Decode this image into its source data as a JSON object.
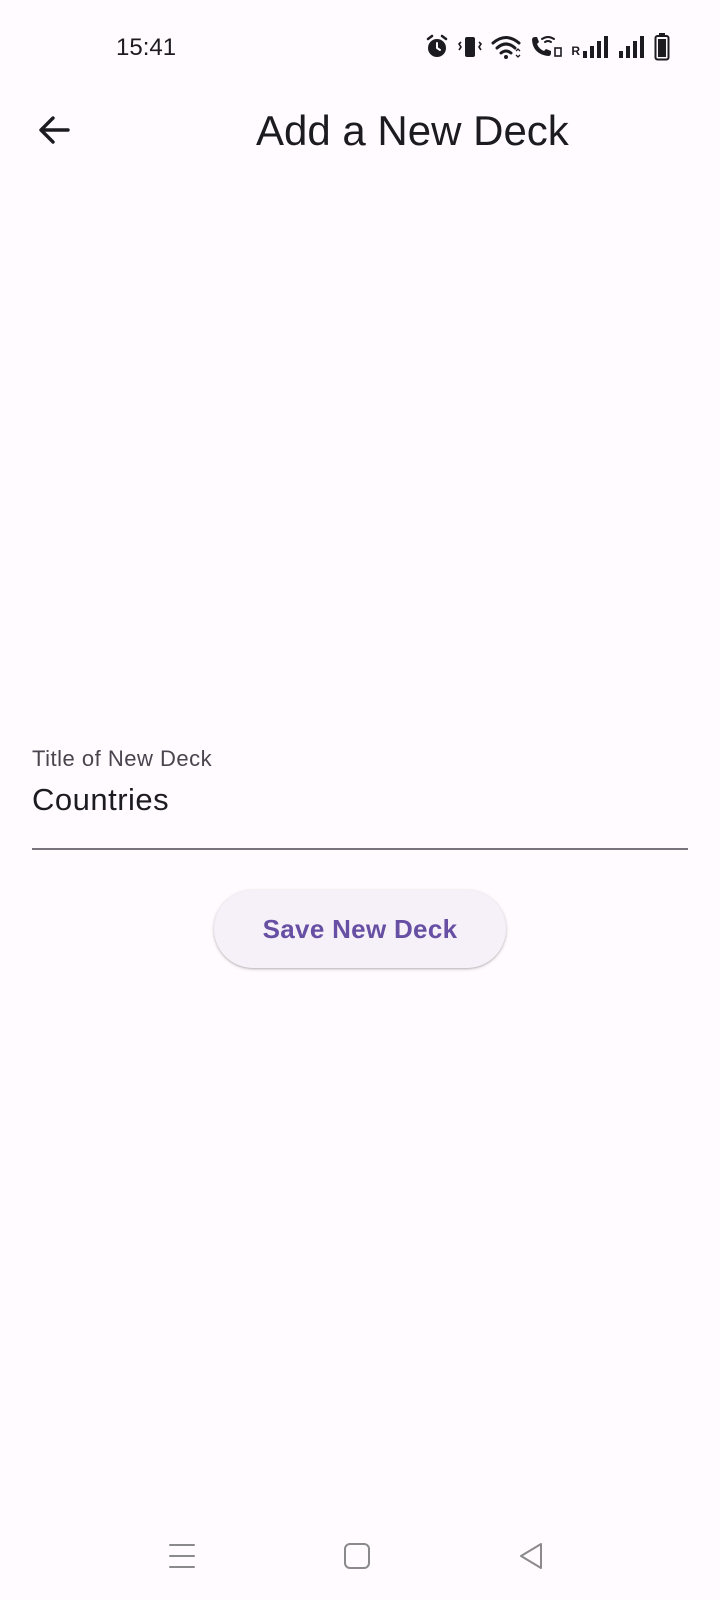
{
  "status_bar": {
    "time": "15:41",
    "icons": [
      "alarm-icon",
      "vibrate-icon",
      "wifi-icon",
      "wifi-calling-icon",
      "signal-roaming-icon",
      "signal-icon",
      "battery-icon"
    ],
    "roaming_letter": "R"
  },
  "app_bar": {
    "back_icon": "arrow-back-icon",
    "title": "Add a New Deck"
  },
  "form": {
    "title_field": {
      "label": "Title of New Deck",
      "value": "Countries"
    },
    "save_button_label": "Save New Deck"
  },
  "nav_bar": {
    "icons": [
      "recents-menu-icon",
      "home-square-icon",
      "back-triangle-icon"
    ]
  },
  "colors": {
    "background": "#fffbfe",
    "primary": "#6750a4",
    "button_surface": "#f6f0f8",
    "underline": "#79747e"
  }
}
